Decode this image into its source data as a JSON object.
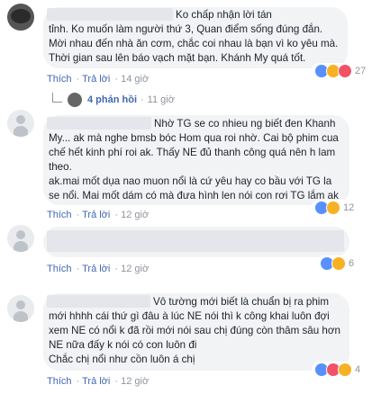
{
  "colors": {
    "link": "#4267b2",
    "meta": "#90949c",
    "bubble": "#f2f3f5"
  },
  "comments": [
    {
      "text_lines": [
        "Ko chấp nhận lời tán",
        "tỉnh. Ko muốn làm người thứ 3, Quan điểm sống đúng đắn.",
        "Mời nhau đến nhà ăn cơm, chắc coi nhau là bạn vì ko yêu mà.",
        "Thời gian sau lên báo vạch mặt bạn. Khánh My quá tốt."
      ],
      "like": "Thích",
      "reply": "Trả lời",
      "time": "14 giờ",
      "reaction_count": "27",
      "replies_label": "4 phản hồi",
      "replies_time": "11 giờ"
    },
    {
      "text_lines": [
        "Nhờ TG se co nhieu ng biết đen Khanh",
        "My... ak mà nghe bmsb bóc Hom qua roi nhờ. Cai bộ phim cua",
        "chế hết kinh phí roi ak. Thấy NE đủ thanh công quá nên h lam",
        "theo.",
        "ak.mai mốt dụa nao muon nổi là cứ yêu hay co bầu với TG la",
        "se nổi. Mai mốt dám có mà đưa hình len nói con rơi TG lắm ak"
      ],
      "like": "Thích",
      "reply": "Trả lời",
      "time": "12 giờ",
      "reaction_count": "12"
    },
    {
      "text_lines": [],
      "like": "Thích",
      "reply": "Trả lời",
      "time": "12 giờ",
      "reaction_count": "6"
    },
    {
      "text_lines": [
        "Vô tường mới biết là chuẩn bị ra phim",
        "mới hhhh cái thứ gì đâu à lúc NE nói thì k công khai luôn đợi",
        "xem NE có nổi k đã rồi mới nói sau chị đúng còn thâm sâu hơn",
        "NE nữa đấy k nói có con luôn đi",
        "Chắc chị nổi như cồn luôn á chị"
      ],
      "like": "Thích",
      "reply": "Trả lời",
      "time": "12 giờ",
      "reaction_count": "4"
    }
  ]
}
